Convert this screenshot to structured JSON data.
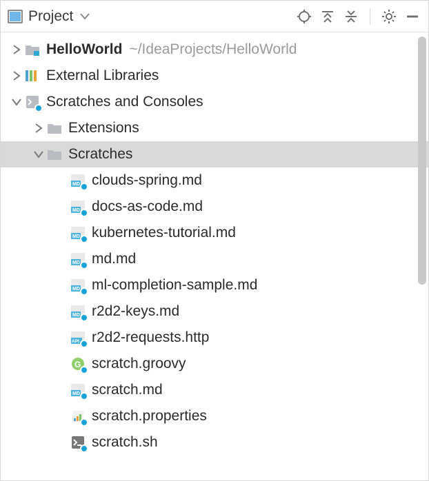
{
  "toolbar": {
    "title": "Project"
  },
  "tree": {
    "helloWorld": {
      "label": "HelloWorld",
      "hint": "~/IdeaProjects/HelloWorld"
    },
    "externalLibs": {
      "label": "External Libraries"
    },
    "scratchesConsoles": {
      "label": "Scratches and Consoles"
    },
    "extensions": {
      "label": "Extensions"
    },
    "scratches": {
      "label": "Scratches"
    },
    "files": [
      {
        "name": "clouds-spring.md",
        "type": "md"
      },
      {
        "name": "docs-as-code.md",
        "type": "md"
      },
      {
        "name": "kubernetes-tutorial.md",
        "type": "md"
      },
      {
        "name": "md.md",
        "type": "md"
      },
      {
        "name": "ml-completion-sample.md",
        "type": "md"
      },
      {
        "name": "r2d2-keys.md",
        "type": "md"
      },
      {
        "name": "r2d2-requests.http",
        "type": "api"
      },
      {
        "name": "scratch.groovy",
        "type": "groovy"
      },
      {
        "name": "scratch.md",
        "type": "md"
      },
      {
        "name": "scratch.properties",
        "type": "props"
      },
      {
        "name": "scratch.sh",
        "type": "sh"
      }
    ]
  }
}
